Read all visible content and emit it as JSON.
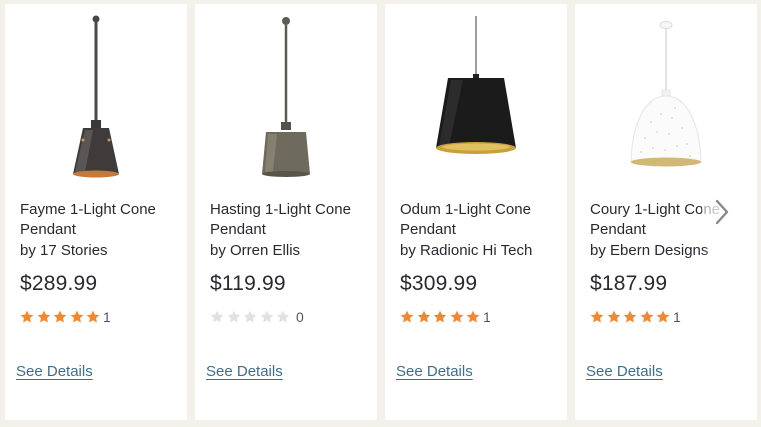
{
  "products": [
    {
      "title": "Fayme 1-Light Cone Pendant",
      "brand": "by 17 Stories",
      "price": "$289.99",
      "rating": 5,
      "review_count": "1",
      "link_label": "See Details",
      "image_icon": "black-cone-pendant-image"
    },
    {
      "title": "Hasting 1-Light Cone Pendant",
      "brand": "by Orren Ellis",
      "price": "$119.99",
      "rating": 0,
      "review_count": "0",
      "link_label": "See Details",
      "image_icon": "bronze-drum-pendant-image"
    },
    {
      "title": "Odum 1-Light Cone Pendant",
      "brand": "by Radionic Hi Tech",
      "price": "$309.99",
      "rating": 5,
      "review_count": "1",
      "link_label": "See Details",
      "image_icon": "black-gold-cone-pendant-image"
    },
    {
      "title": "Coury 1-Light Cone Pendant",
      "brand": "by Ebern Designs",
      "price": "$187.99",
      "rating": 5,
      "review_count": "1",
      "link_label": "See Details",
      "image_icon": "white-dome-pendant-image"
    }
  ],
  "carousel": {
    "next_icon": "chevron-right-icon"
  },
  "colors": {
    "star_filled": "#f5872b",
    "star_empty": "#e2e0e4",
    "link": "#3c6f8e",
    "text": "#2b2830",
    "page_bg": "#f3f1ea"
  }
}
